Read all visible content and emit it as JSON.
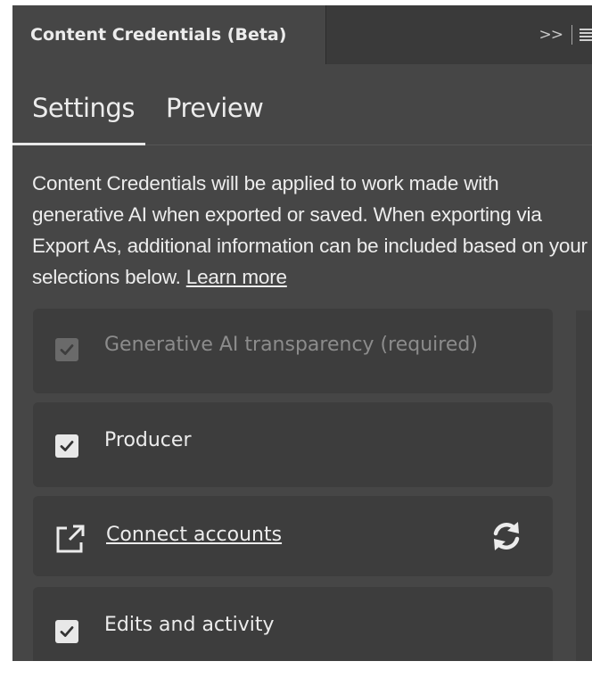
{
  "panel": {
    "tab_title": "Content Credentials (Beta)",
    "collapse_glyph": ">>",
    "menu_icon": "hamburger-menu-icon"
  },
  "tabs": [
    {
      "label": "Settings",
      "selected": true
    },
    {
      "label": "Preview",
      "selected": false
    }
  ],
  "description": {
    "text": "Content Credentials will be applied to work made with generative AI when exported or saved. When exporting via Export As, additional information can be included based on your selections below. ",
    "link": "Learn more"
  },
  "options": [
    {
      "label": "Generative AI transparency (required)",
      "checked": true,
      "disabled": true
    },
    {
      "label": "Producer",
      "checked": true,
      "disabled": false
    },
    {
      "label": "Connect accounts",
      "type": "link",
      "icon": "external-link-icon",
      "action_icon": "refresh-icon"
    },
    {
      "label": "Edits and activity",
      "checked": true,
      "disabled": false
    }
  ],
  "colors": {
    "panel_bg": "#464646",
    "row_bg": "#3d3d3d",
    "text": "#ececec",
    "disabled_text": "#8c8c8c"
  }
}
